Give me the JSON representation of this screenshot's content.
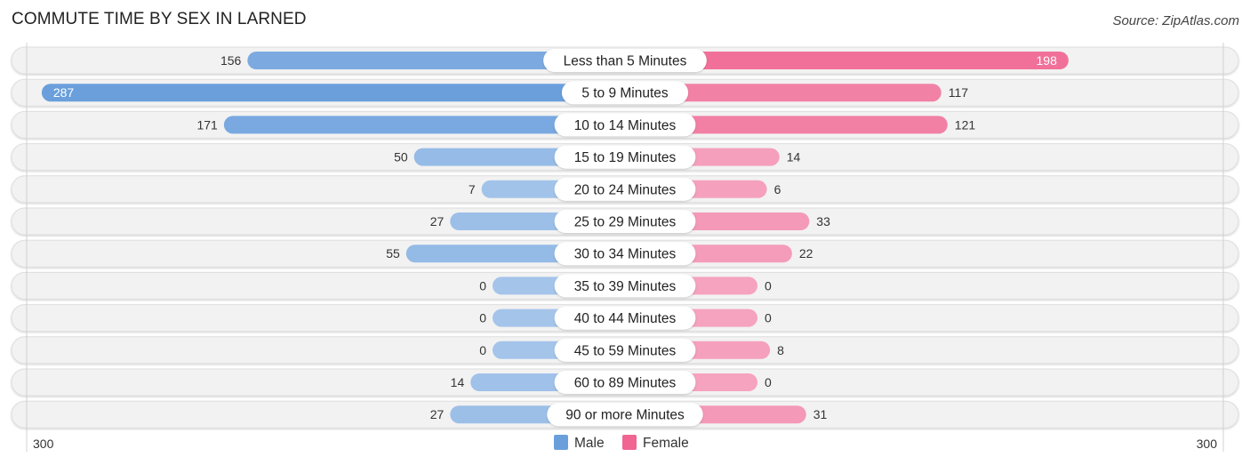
{
  "title": "COMMUTE TIME BY SEX IN LARNED",
  "source": "Source: ZipAtlas.com",
  "colors": {
    "male": "#6a9fdc",
    "male_light": "#a4c4ea",
    "female": "#f06591",
    "female_light": "#f5a3bf",
    "track": "#f2f2f2"
  },
  "chart_data": {
    "type": "bar",
    "orientation": "horizontal-diverging",
    "title": "COMMUTE TIME BY SEX IN LARNED",
    "categories": [
      "Less than 5 Minutes",
      "5 to 9 Minutes",
      "10 to 14 Minutes",
      "15 to 19 Minutes",
      "20 to 24 Minutes",
      "25 to 29 Minutes",
      "30 to 34 Minutes",
      "35 to 39 Minutes",
      "40 to 44 Minutes",
      "45 to 59 Minutes",
      "60 to 89 Minutes",
      "90 or more Minutes"
    ],
    "series": [
      {
        "name": "Male",
        "values": [
          156,
          287,
          171,
          50,
          7,
          27,
          55,
          0,
          0,
          0,
          14,
          27
        ]
      },
      {
        "name": "Female",
        "values": [
          198,
          117,
          121,
          14,
          6,
          33,
          22,
          0,
          0,
          8,
          0,
          31
        ]
      }
    ],
    "axis": {
      "left_label": "300",
      "right_label": "300",
      "range": [
        0,
        300
      ]
    },
    "legend": {
      "position": "bottom-center",
      "entries": [
        "Male",
        "Female"
      ]
    },
    "grid": false
  }
}
